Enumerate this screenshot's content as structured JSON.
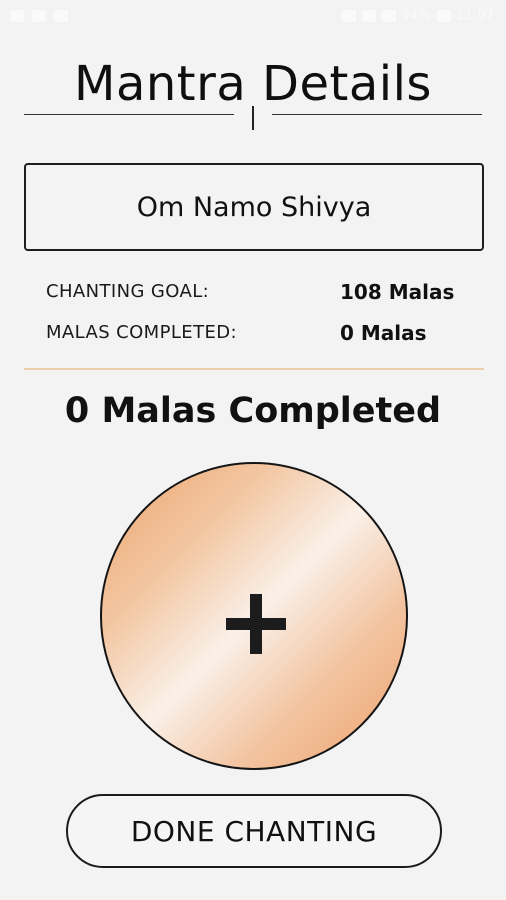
{
  "status_bar": {
    "left_icons": [
      "image-icon",
      "warning-icon",
      "youtube-icon"
    ],
    "right_icons": [
      "sim-icon",
      "signal-icon",
      "signal-icon",
      "battery-icon"
    ],
    "battery": "94%",
    "time": "11:07"
  },
  "header": {
    "title": "Mantra Details"
  },
  "mantra": {
    "name": "Om Namo Shivya"
  },
  "stats": {
    "goal_label": "CHANTING GOAL:",
    "goal_value": "108 Malas",
    "completed_label": "MALAS COMPLETED:",
    "completed_value": "0 Malas"
  },
  "progress": {
    "heading": "0 Malas Completed"
  },
  "counter": {
    "icon": "plus-icon",
    "gradient_colors": [
      "#eaa36c",
      "#faf0e8",
      "#eca26a"
    ]
  },
  "actions": {
    "done_label": "DONE CHANTING"
  },
  "colors": {
    "background": "#f3f3f3",
    "divider": "#efcfab",
    "text": "#111111"
  }
}
